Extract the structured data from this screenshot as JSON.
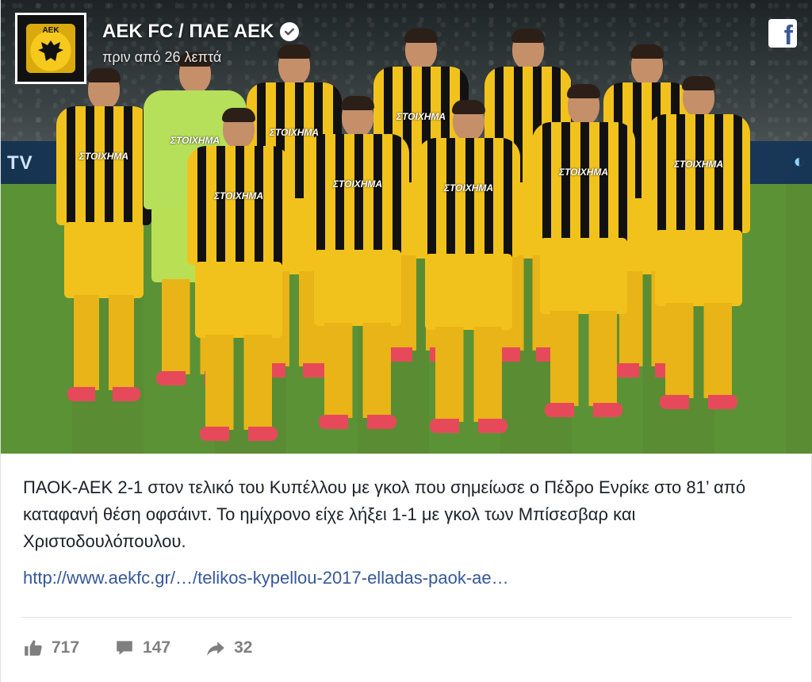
{
  "post": {
    "page_name": "AEK FC / ΠΑΕ ΑΕΚ",
    "timestamp": "πριν από 26 λεπτά",
    "crest_text": "ΑΕΚ",
    "photo": {
      "ad_board_left": "TV",
      "sponsor": "ΣΤΟΙΧΗΜΑ"
    },
    "text": "ΠΑΟΚ-ΑΕΚ 2-1 στον τελικό του Κυπέλλου με γκολ που σημείωσε ο Πέδρο Ενρίκε στο 81’ από καταφανή θέση οφσάιντ. Το ημίχρονο είχε λήξει 1-1 με γκολ των Μπίσεσβαρ και Χριστοδουλόπουλου.",
    "link_text": "http://www.aekfc.gr/…/telikos-kypellou-2017-elladas-paok-ae…",
    "icons": {
      "verified": "verified-check-icon",
      "facebook": "facebook-logo-icon",
      "like": "thumbs-up-icon",
      "comment": "comment-bubble-icon",
      "share": "share-arrow-icon"
    }
  },
  "stats": {
    "likes": "717",
    "comments": "147",
    "shares": "32"
  },
  "colors": {
    "link": "#365899",
    "text": "#1d2129",
    "stat_gray": "#7f7f7f",
    "facebook_blue": "#3b5998",
    "aek_yellow": "#f2c21c"
  }
}
